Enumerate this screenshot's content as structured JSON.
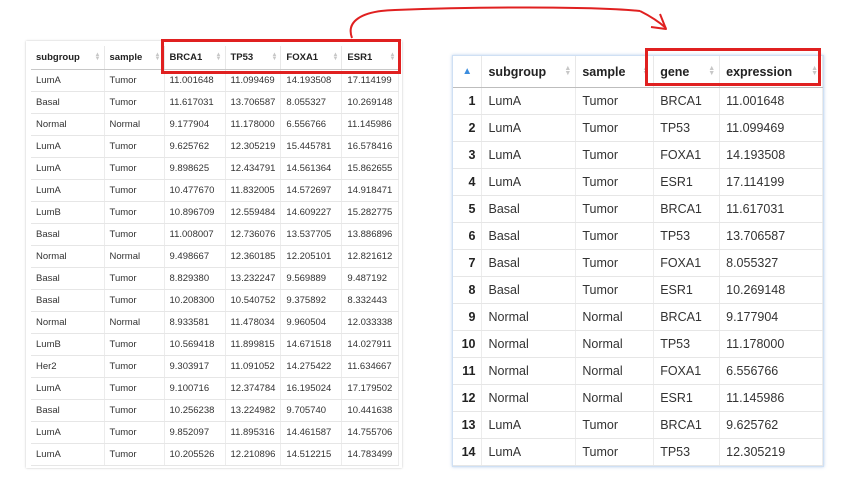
{
  "wide_table": {
    "headers": [
      "subgroup",
      "sample",
      "BRCA1",
      "TP53",
      "FOXA1",
      "ESR1"
    ],
    "rows": [
      [
        "LumA",
        "Tumor",
        "11.001648",
        "11.099469",
        "14.193508",
        "17.114199"
      ],
      [
        "Basal",
        "Tumor",
        "11.617031",
        "13.706587",
        "8.055327",
        "10.269148"
      ],
      [
        "Normal",
        "Normal",
        "9.177904",
        "11.178000",
        "6.556766",
        "11.145986"
      ],
      [
        "LumA",
        "Tumor",
        "9.625762",
        "12.305219",
        "15.445781",
        "16.578416"
      ],
      [
        "LumA",
        "Tumor",
        "9.898625",
        "12.434791",
        "14.561364",
        "15.862655"
      ],
      [
        "LumA",
        "Tumor",
        "10.477670",
        "11.832005",
        "14.572697",
        "14.918471"
      ],
      [
        "LumB",
        "Tumor",
        "10.896709",
        "12.559484",
        "14.609227",
        "15.282775"
      ],
      [
        "Basal",
        "Tumor",
        "11.008007",
        "12.736076",
        "13.537705",
        "13.886896"
      ],
      [
        "Normal",
        "Normal",
        "9.498667",
        "12.360185",
        "12.205101",
        "12.821612"
      ],
      [
        "Basal",
        "Tumor",
        "8.829380",
        "13.232247",
        "9.569889",
        "9.487192"
      ],
      [
        "Basal",
        "Tumor",
        "10.208300",
        "10.540752",
        "9.375892",
        "8.332443"
      ],
      [
        "Normal",
        "Normal",
        "8.933581",
        "11.478034",
        "9.960504",
        "12.033338"
      ],
      [
        "LumB",
        "Tumor",
        "10.569418",
        "11.899815",
        "14.671518",
        "14.027911"
      ],
      [
        "Her2",
        "Tumor",
        "9.303917",
        "11.091052",
        "14.275422",
        "11.634667"
      ],
      [
        "LumA",
        "Tumor",
        "9.100716",
        "12.374784",
        "16.195024",
        "17.179502"
      ],
      [
        "Basal",
        "Tumor",
        "10.256238",
        "13.224982",
        "9.705740",
        "10.441638"
      ],
      [
        "LumA",
        "Tumor",
        "9.852097",
        "11.895316",
        "14.461587",
        "14.755706"
      ],
      [
        "LumA",
        "Tumor",
        "10.205526",
        "12.210896",
        "14.512215",
        "14.783499"
      ]
    ]
  },
  "long_table": {
    "sort_indicator": "▲",
    "headers": [
      "subgroup",
      "sample",
      "gene",
      "expression"
    ],
    "rows": [
      [
        "1",
        "LumA",
        "Tumor",
        "BRCA1",
        "11.001648"
      ],
      [
        "2",
        "LumA",
        "Tumor",
        "TP53",
        "11.099469"
      ],
      [
        "3",
        "LumA",
        "Tumor",
        "FOXA1",
        "14.193508"
      ],
      [
        "4",
        "LumA",
        "Tumor",
        "ESR1",
        "17.114199"
      ],
      [
        "5",
        "Basal",
        "Tumor",
        "BRCA1",
        "11.617031"
      ],
      [
        "6",
        "Basal",
        "Tumor",
        "TP53",
        "13.706587"
      ],
      [
        "7",
        "Basal",
        "Tumor",
        "FOXA1",
        "8.055327"
      ],
      [
        "8",
        "Basal",
        "Tumor",
        "ESR1",
        "10.269148"
      ],
      [
        "9",
        "Normal",
        "Normal",
        "BRCA1",
        "9.177904"
      ],
      [
        "10",
        "Normal",
        "Normal",
        "TP53",
        "11.178000"
      ],
      [
        "11",
        "Normal",
        "Normal",
        "FOXA1",
        "6.556766"
      ],
      [
        "12",
        "Normal",
        "Normal",
        "ESR1",
        "11.145986"
      ],
      [
        "13",
        "LumA",
        "Tumor",
        "BRCA1",
        "9.625762"
      ],
      [
        "14",
        "LumA",
        "Tumor",
        "TP53",
        "12.305219"
      ]
    ]
  },
  "colors": {
    "highlight": "#e02020",
    "arrow": "#e02020",
    "sort_active": "#3c8dde"
  }
}
